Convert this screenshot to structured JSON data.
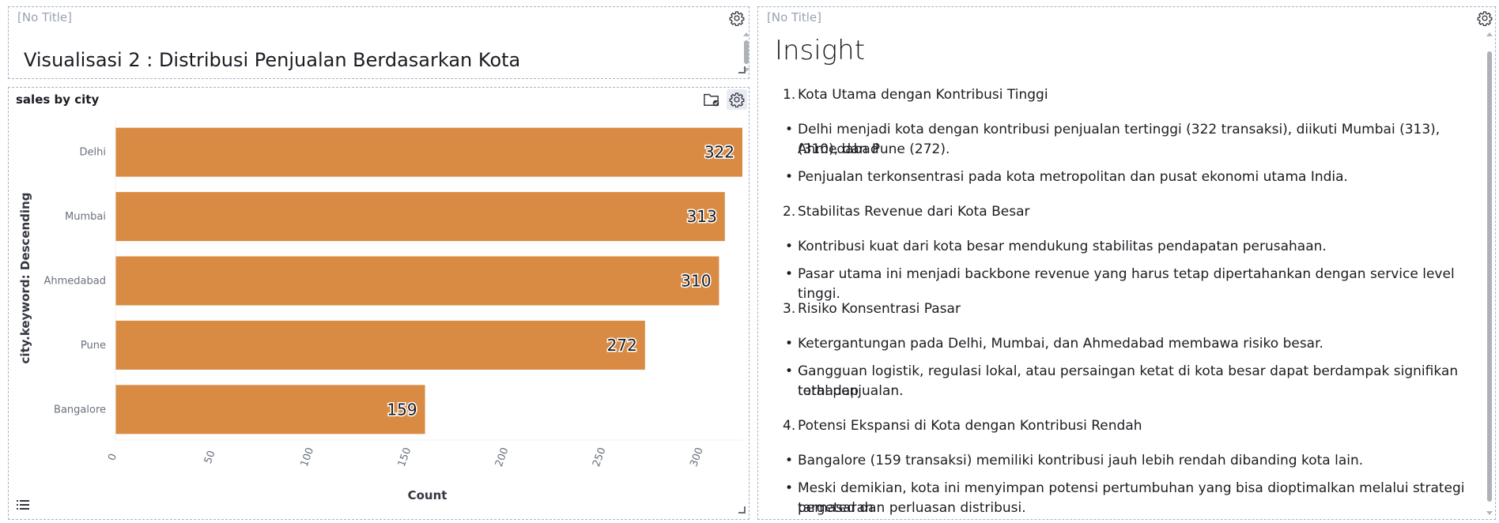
{
  "left_top_panel": {
    "title": "[No Title]",
    "heading": "Visualisasi 2 : Distribusi Penjualan Berdasarkan Kota"
  },
  "chart_panel": {
    "title": "sales by city"
  },
  "chart_data": {
    "type": "bar",
    "orientation": "horizontal",
    "categories": [
      "Delhi",
      "Mumbai",
      "Ahmedabad",
      "Pune",
      "Bangalore"
    ],
    "values": [
      322,
      313,
      310,
      272,
      159
    ],
    "xlabel": "Count",
    "ylabel": "city.keyword: Descending",
    "xticks": [
      "0",
      "50",
      "100",
      "150",
      "200",
      "250",
      "300"
    ],
    "xlim": [
      0,
      322
    ],
    "bar_color": "#d98b43"
  },
  "right_panel": {
    "title": "[No Title]",
    "heading": "Insight",
    "sections": [
      {
        "number": "1.",
        "title": "Kota Utama dengan Kontribusi Tinggi",
        "bullets": [
          [
            "Delhi menjadi kota dengan kontribusi penjualan tertinggi (322 transaksi), diikuti Mumbai (313), Ahmedabad",
            "(310), dan Pune (272)."
          ],
          [
            "Penjualan terkonsentrasi pada kota metropolitan dan pusat ekonomi utama India."
          ]
        ]
      },
      {
        "number": "2.",
        "title": "Stabilitas Revenue dari Kota Besar",
        "bullets": [
          [
            "Kontribusi kuat dari kota besar mendukung stabilitas pendapatan perusahaan."
          ],
          [
            "Pasar utama ini menjadi backbone revenue yang harus tetap dipertahankan dengan service level tinggi."
          ]
        ]
      },
      {
        "number": "3.",
        "title": "Risiko Konsentrasi Pasar",
        "bullets": [
          [
            "Ketergantungan pada Delhi, Mumbai, dan Ahmedabad membawa risiko besar."
          ],
          [
            "Gangguan logistik, regulasi lokal, atau persaingan ketat di kota besar dapat berdampak signifikan terhadap",
            "total penjualan."
          ]
        ]
      },
      {
        "number": "4.",
        "title": "Potensi Ekspansi di Kota dengan Kontribusi Rendah",
        "bullets": [
          [
            "Bangalore (159 transaksi) memiliki kontribusi jauh lebih rendah dibanding kota lain."
          ],
          [
            "Meski demikian, kota ini menyimpan potensi pertumbuhan yang bisa dioptimalkan melalui strategi pemasaran",
            "targeted dan perluasan distribusi."
          ]
        ]
      }
    ]
  },
  "colors": {
    "accent_bar": "#d98b43",
    "panel_border": "#a7b3c8",
    "muted_text": "#98a2b3"
  }
}
